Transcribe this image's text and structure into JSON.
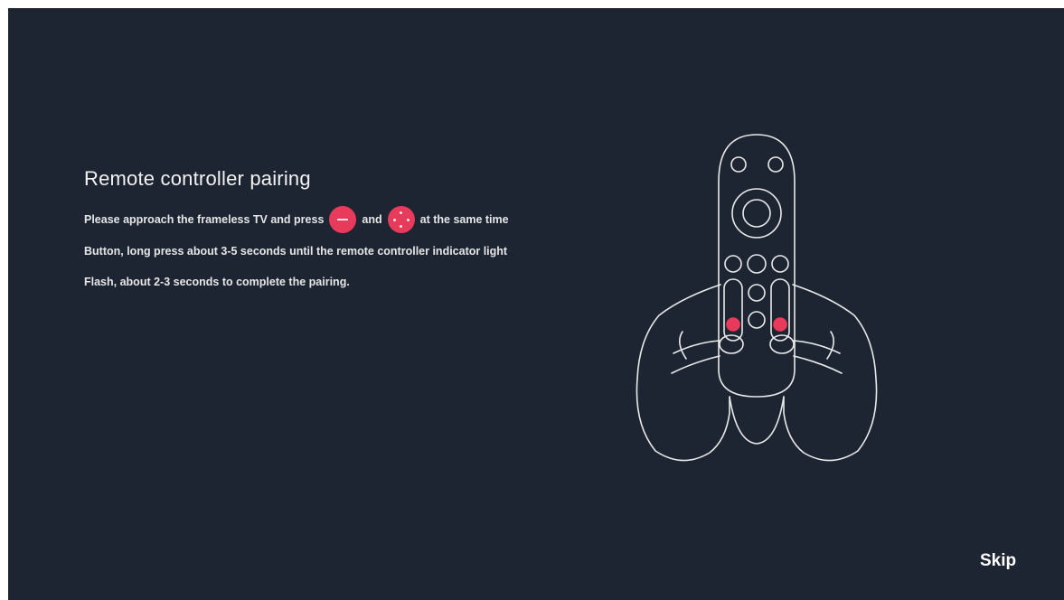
{
  "pairing": {
    "title": "Remote controller pairing",
    "line1_before": "Please approach the frameless TV and press",
    "line1_mid": "and",
    "line1_after": "at the same time",
    "line2": "Button, long press about 3-5 seconds until the remote controller indicator light",
    "line3": "Flash, about 2-3 seconds to complete the pairing."
  },
  "icons": {
    "button_one": "minus-button-icon",
    "button_two": "dpad-button-icon",
    "illustration": "hands-holding-remote-illustration"
  },
  "footer": {
    "skip_label": "Skip"
  },
  "colors": {
    "background": "#1d2532",
    "accent": "#e83a5a",
    "text": "#ffffff"
  }
}
